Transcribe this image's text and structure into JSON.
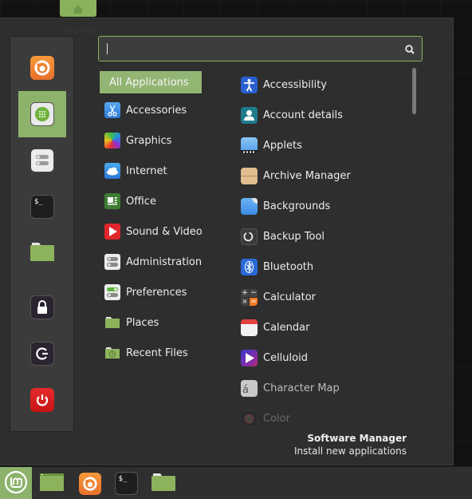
{
  "tooltip": {
    "text": "Home"
  },
  "search": {
    "value": "",
    "placeholder": ""
  },
  "sidebar": {
    "items": [
      {
        "name": "firefox",
        "label": "Firefox Web Browser"
      },
      {
        "name": "software-manager",
        "label": "Software Manager",
        "active": true
      },
      {
        "name": "system-settings",
        "label": "System Settings"
      },
      {
        "name": "terminal",
        "label": "Terminal"
      },
      {
        "name": "files",
        "label": "Files"
      },
      {
        "name": "lock-screen",
        "label": "Lock Screen"
      },
      {
        "name": "logout",
        "label": "Logout"
      },
      {
        "name": "quit",
        "label": "Quit"
      }
    ]
  },
  "categories": [
    {
      "label": "All Applications",
      "active": true
    },
    {
      "label": "Accessories",
      "icon": "scissors-icon"
    },
    {
      "label": "Graphics",
      "icon": "graphics-icon"
    },
    {
      "label": "Internet",
      "icon": "cloud-icon"
    },
    {
      "label": "Office",
      "icon": "office-icon"
    },
    {
      "label": "Sound & Video",
      "icon": "play-icon"
    },
    {
      "label": "Administration",
      "icon": "toggles-icon"
    },
    {
      "label": "Preferences",
      "icon": "preferences-icon"
    },
    {
      "label": "Places",
      "icon": "folder-icon"
    },
    {
      "label": "Recent Files",
      "icon": "recent-folder-icon"
    }
  ],
  "apps": [
    {
      "label": "Accessibility",
      "icon": "accessibility-icon"
    },
    {
      "label": "Account details",
      "icon": "user-icon"
    },
    {
      "label": "Applets",
      "icon": "applets-icon"
    },
    {
      "label": "Archive Manager",
      "icon": "archive-icon"
    },
    {
      "label": "Backgrounds",
      "icon": "backgrounds-icon"
    },
    {
      "label": "Backup Tool",
      "icon": "backup-icon"
    },
    {
      "label": "Bluetooth",
      "icon": "bluetooth-icon"
    },
    {
      "label": "Calculator",
      "icon": "calculator-icon"
    },
    {
      "label": "Calendar",
      "icon": "calendar-icon"
    },
    {
      "label": "Celluloid",
      "icon": "celluloid-icon"
    },
    {
      "label": "Character Map",
      "icon": "character-map-icon",
      "glyph": "á"
    },
    {
      "label": "Color",
      "icon": "color-icon"
    }
  ],
  "calculator_glyphs": [
    "+",
    "−",
    "×",
    "="
  ],
  "footer": {
    "title": "Software Manager",
    "description": "Install new applications"
  },
  "terminal_glyph": "$_",
  "taskbar": {
    "items": [
      {
        "name": "menu",
        "label": "Menu"
      },
      {
        "name": "show-desktop",
        "label": "Show Desktop"
      },
      {
        "name": "firefox",
        "label": "Firefox"
      },
      {
        "name": "terminal",
        "label": "Terminal"
      },
      {
        "name": "files",
        "label": "Files"
      }
    ]
  },
  "colors": {
    "accent": "#8db26b",
    "menu_bg": "#2e2e2e",
    "sidebar_bg": "#3b3b3b",
    "taskbar_bg": "#2f2f2f"
  }
}
